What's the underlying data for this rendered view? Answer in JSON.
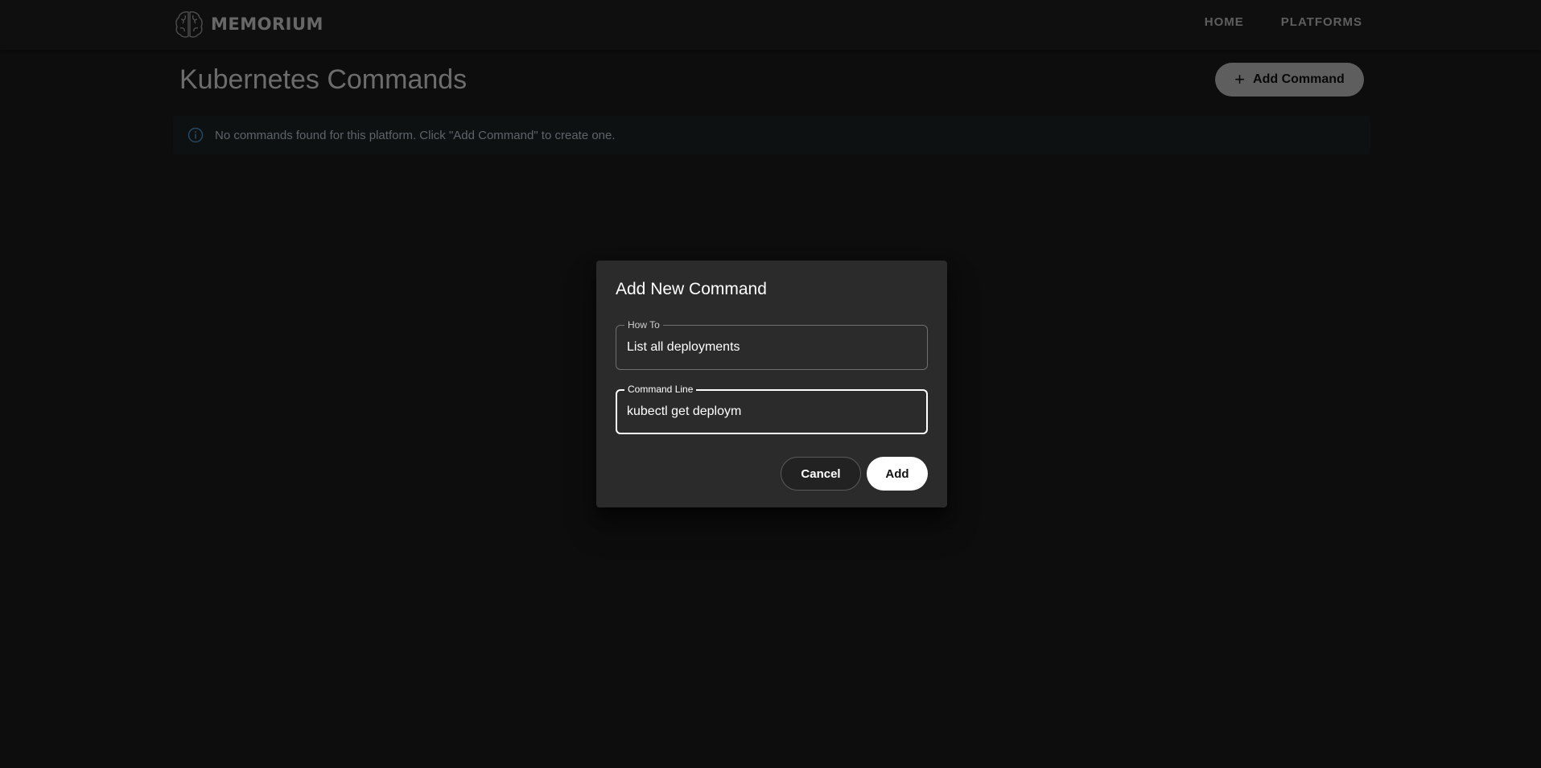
{
  "brand": {
    "name": "MEMORIUM",
    "icon": "brain-icon"
  },
  "nav": {
    "home_label": "HOME",
    "platforms_label": "PLATFORMS"
  },
  "page": {
    "title": "Kubernetes Commands",
    "add_command_label": "Add Command",
    "add_icon": "plus-icon"
  },
  "alert": {
    "icon": "info-icon",
    "message": "No commands found for this platform. Click \"Add Command\" to create one."
  },
  "dialog": {
    "title": "Add New Command",
    "how_to": {
      "label": "How To",
      "value": "List all deployments"
    },
    "command_line": {
      "label": "Command Line",
      "value": "kubectl get deploym"
    },
    "cancel_label": "Cancel",
    "add_label": "Add"
  },
  "colors": {
    "background": "#1b1b1b",
    "appbar": "#1f1f1f",
    "dialog": "#2b2b2b",
    "alert_bg": "#1d2225",
    "info_blue": "#4a90c8",
    "primary_button": "#ffffff"
  }
}
